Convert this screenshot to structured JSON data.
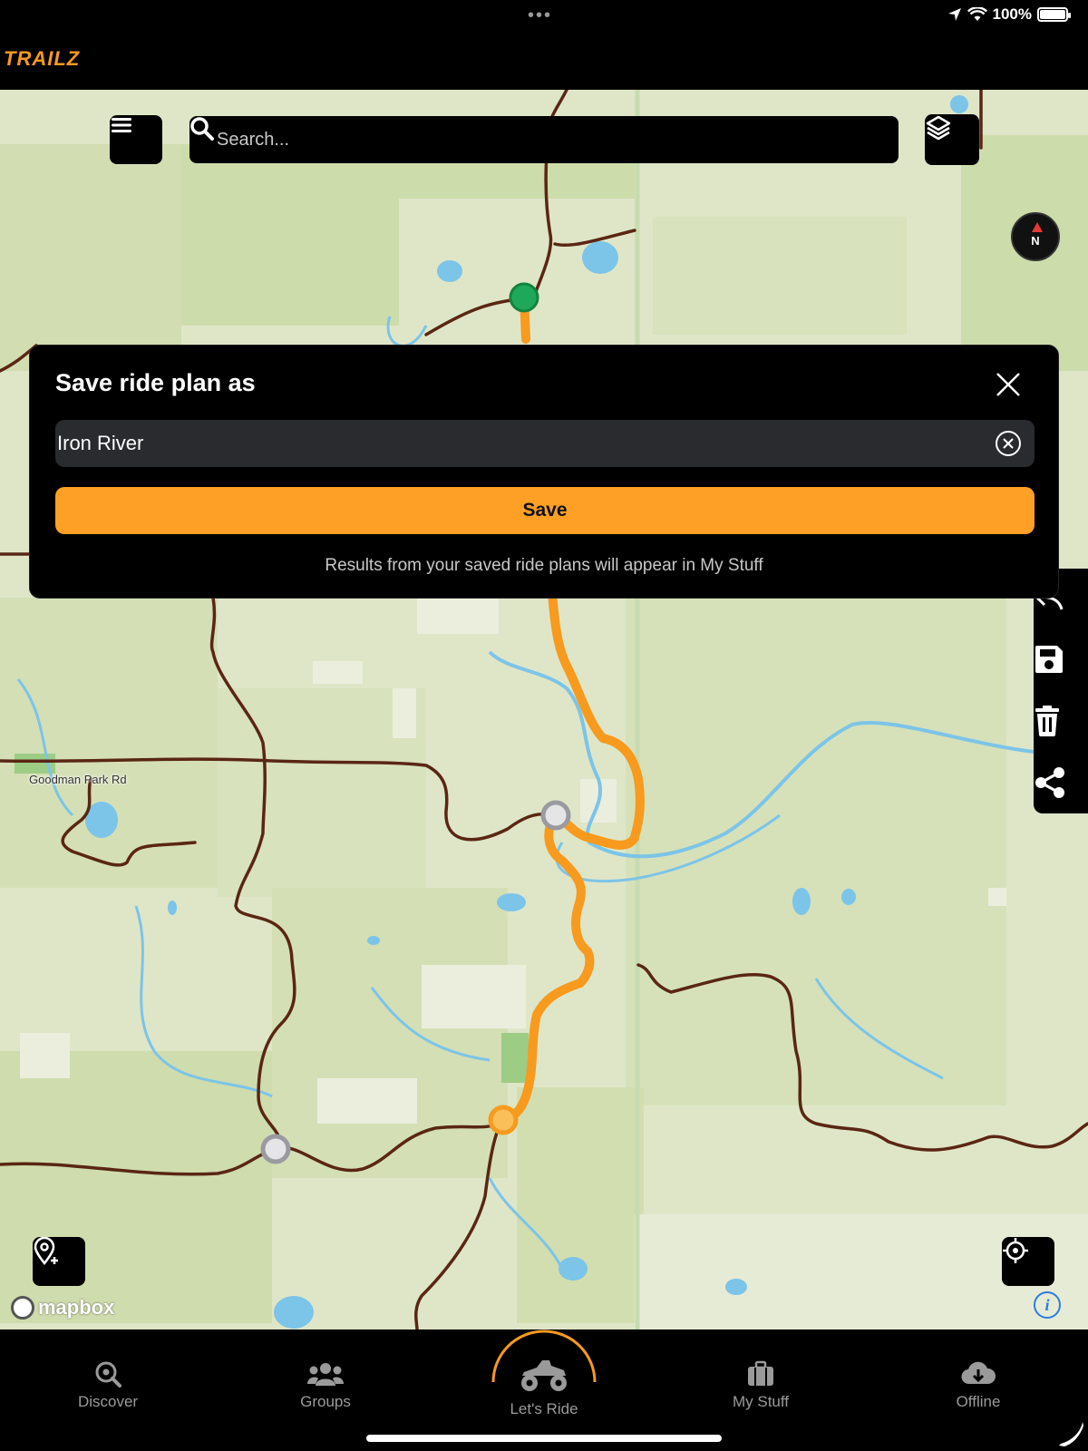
{
  "status": {
    "battery_text": "100%",
    "battery_level": 1.0,
    "dots": "•••"
  },
  "app": {
    "logo_text": "TRAILZ"
  },
  "map": {
    "search_placeholder": "Search...",
    "road_label": "Goodman Park Rd",
    "compass_label": "N",
    "attribution": "mapbox",
    "info_label": "i",
    "icons": {
      "menu": "hamburger-menu-icon",
      "layers": "layers-icon",
      "add_pin": "add-location-pin-icon",
      "locate": "crosshair-locate-icon",
      "undo": "undo-icon",
      "save": "floppy-disk-icon",
      "delete": "trash-icon",
      "share": "share-icon"
    },
    "colors": {
      "route": "#f79a1e",
      "road": "#5a2614",
      "water": "#7cc4e8",
      "land": "#dfe6c8",
      "start_marker": "#1fa85a",
      "waypoint_marker": "#c8c8cc",
      "end_marker": "#f79a1e"
    }
  },
  "dialog": {
    "title": "Save ride plan as",
    "name_value": "Iron River",
    "save_label": "Save",
    "hint": "Results from your saved ride plans will appear in My Stuff",
    "accent": "#fea025"
  },
  "tabs": [
    {
      "label": "Discover",
      "icon": "discover-search-icon"
    },
    {
      "label": "Groups",
      "icon": "groups-icon"
    },
    {
      "label": "Let's Ride",
      "icon": "atv-icon",
      "active": true
    },
    {
      "label": "My Stuff",
      "icon": "briefcase-icon"
    },
    {
      "label": "Offline",
      "icon": "cloud-download-icon"
    }
  ]
}
